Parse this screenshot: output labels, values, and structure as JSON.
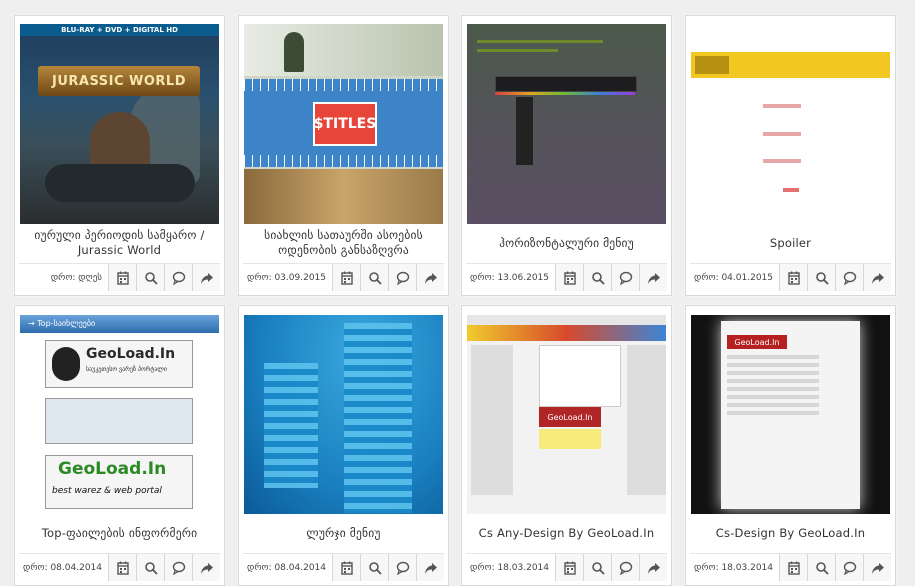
{
  "cards": [
    {
      "title": "იურული პერიოდის სამყარო / Jurassic World",
      "date": "დრო: დღეს",
      "thumb_text": {
        "bar": "BLU-RAY + DVD + DIGITAL HD",
        "logo": "JURASSIC WORLD"
      }
    },
    {
      "title": "სიახლის სათაურში ასოების ოდენობის განსაზღვრა",
      "date": "დრო: 03.09.2015",
      "thumb_text": {
        "tag": "$TITLES"
      }
    },
    {
      "title": "ჰორიზონტალური მენიუ",
      "date": "დრო: 13.06.2015"
    },
    {
      "title": "Spoiler",
      "date": "დრო: 04.01.2015"
    },
    {
      "title": "Top-ფაილების ინფორმერი",
      "date": "დრო: 08.04.2014",
      "thumb_text": {
        "header": "→ Top-საიხლეები",
        "logo1": "GeoLoad.In",
        "logo1_sub": "საუკეთესო ვარეზ პორტალი",
        "logo2": "GeoLoad.In",
        "logo2_sub": "best warez & web portal"
      }
    },
    {
      "title": "ლურჯი მენიუ",
      "date": "დრო: 08.04.2014"
    },
    {
      "title": "Cs Any-Design By GeoLoad.In",
      "date": "დრო: 18.03.2014",
      "thumb_text": {
        "red": "GeoLoad.In"
      }
    },
    {
      "title": "Cs-Design By GeoLoad.In",
      "date": "დრო: 18.03.2014",
      "thumb_text": {
        "red": "GeoLoad.In"
      }
    }
  ],
  "actions": [
    {
      "name": "calendar-icon"
    },
    {
      "name": "search-icon"
    },
    {
      "name": "comment-icon"
    },
    {
      "name": "share-icon"
    }
  ]
}
